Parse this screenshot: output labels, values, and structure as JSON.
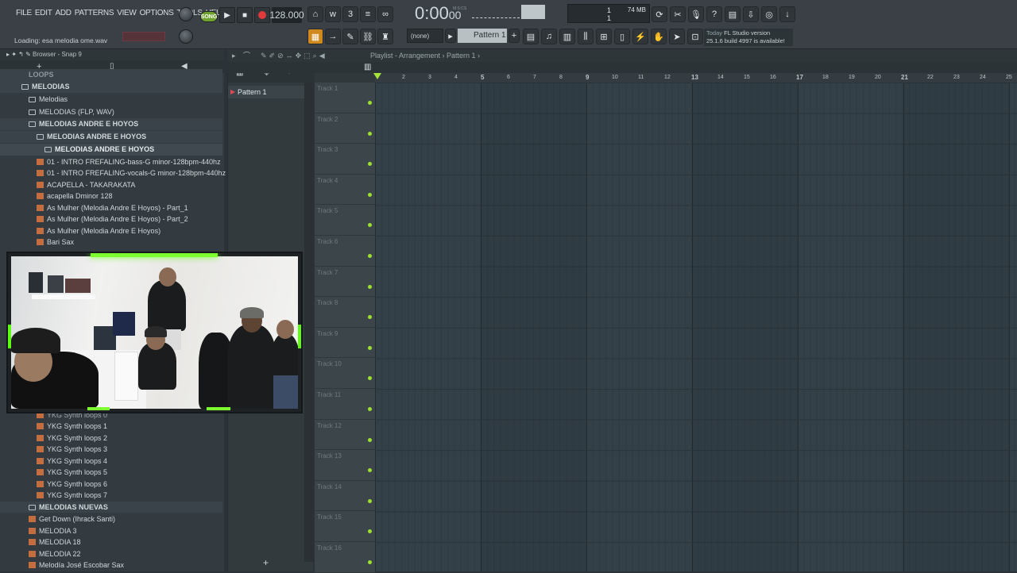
{
  "menu": [
    "FILE",
    "EDIT",
    "ADD",
    "PATTERNS",
    "VIEW",
    "OPTIONS",
    "TOOLS",
    "HELP"
  ],
  "hint": "Loading: esa melodia ome.wav",
  "transport": {
    "song_label": "SONG",
    "bpm": "128.000",
    "time_main": "0:00",
    "time_small": "00",
    "time_unit": "M:S:CS"
  },
  "cpu": {
    "voices": "1",
    "memory": "74 MB",
    "poly": "1"
  },
  "pattern_selector": {
    "none_label": "(none)",
    "pattern_label": "Pattern 1"
  },
  "news": {
    "date": "Today",
    "title": "FL Studio version",
    "body": "25.1.6 build 4997 is available!"
  },
  "browser": {
    "title": "Browser - Snap 9",
    "items": [
      {
        "label": "LOOPS",
        "type": "folder"
      },
      {
        "label": "MELODIAS",
        "type": "folder"
      },
      {
        "label": "Melodias",
        "type": "folder"
      },
      {
        "label": "MELODIAS (FLP, WAV)",
        "type": "folder"
      },
      {
        "label": "MELODIAS ANDRE E HOYOS",
        "type": "folder"
      },
      {
        "label": "MELODIAS ANDRE E HOYOS",
        "type": "folder"
      },
      {
        "label": "MELODIAS ANDRE E HOYOS",
        "type": "folder"
      },
      {
        "label": "01 - INTRO FREFALING-bass-G minor-128bpm-440hz",
        "type": "file"
      },
      {
        "label": "01 - INTRO FREFALING-vocals-G minor-128bpm-440hz",
        "type": "file"
      },
      {
        "label": "ACAPELLA - TAKARAKATA",
        "type": "file"
      },
      {
        "label": "acapella Dminor 128",
        "type": "file"
      },
      {
        "label": "As Mulher (Melodia Andre E Hoyos) - Part_1",
        "type": "file"
      },
      {
        "label": "As Mulher (Melodia Andre E Hoyos) - Part_2",
        "type": "file"
      },
      {
        "label": "As Mulher (Melodia Andre E Hoyos)",
        "type": "file"
      },
      {
        "label": "Bari Sax",
        "type": "file"
      }
    ],
    "items_lower": [
      {
        "label": "YKG Synth loops 0",
        "type": "file"
      },
      {
        "label": "YKG Synth loops 1",
        "type": "file"
      },
      {
        "label": "YKG Synth loops 2",
        "type": "file"
      },
      {
        "label": "YKG Synth loops 3",
        "type": "file"
      },
      {
        "label": "YKG Synth loops 4",
        "type": "file"
      },
      {
        "label": "YKG Synth loops 5",
        "type": "file"
      },
      {
        "label": "YKG Synth loops 6",
        "type": "file"
      },
      {
        "label": "YKG Synth loops 7",
        "type": "file"
      },
      {
        "label": "MELODIAS NUEVAS",
        "type": "folder"
      },
      {
        "label": "Get Down (Ihrack Santi)",
        "type": "file"
      },
      {
        "label": "MELODIA 3",
        "type": "file"
      },
      {
        "label": "MELODIA 18",
        "type": "file"
      },
      {
        "label": "MELODIA 22",
        "type": "file"
      },
      {
        "label": "Melodía José Escobar Sax",
        "type": "file"
      }
    ]
  },
  "picker": {
    "pattern_item": "Pattern 1"
  },
  "playlist": {
    "breadcrumb": "Playlist - Arrangement › Pattern 1 ›",
    "tracks": [
      "Track 1",
      "Track 2",
      "Track 3",
      "Track 4",
      "Track 5",
      "Track 6",
      "Track 7",
      "Track 8",
      "Track 9",
      "Track 10",
      "Track 11",
      "Track 12",
      "Track 13",
      "Track 14",
      "Track 15",
      "Track 16"
    ],
    "bars": [
      "2",
      "3",
      "4",
      "5",
      "6",
      "7",
      "8",
      "9",
      "10",
      "11",
      "12",
      "13",
      "14",
      "15",
      "16",
      "17",
      "18",
      "19",
      "20",
      "21",
      "22",
      "23",
      "24",
      "25"
    ]
  },
  "colors": {
    "accent_green": "#9ee02f",
    "record_red": "#e03a3a",
    "song_green": "#6ea12d",
    "orange": "#d0891c"
  }
}
